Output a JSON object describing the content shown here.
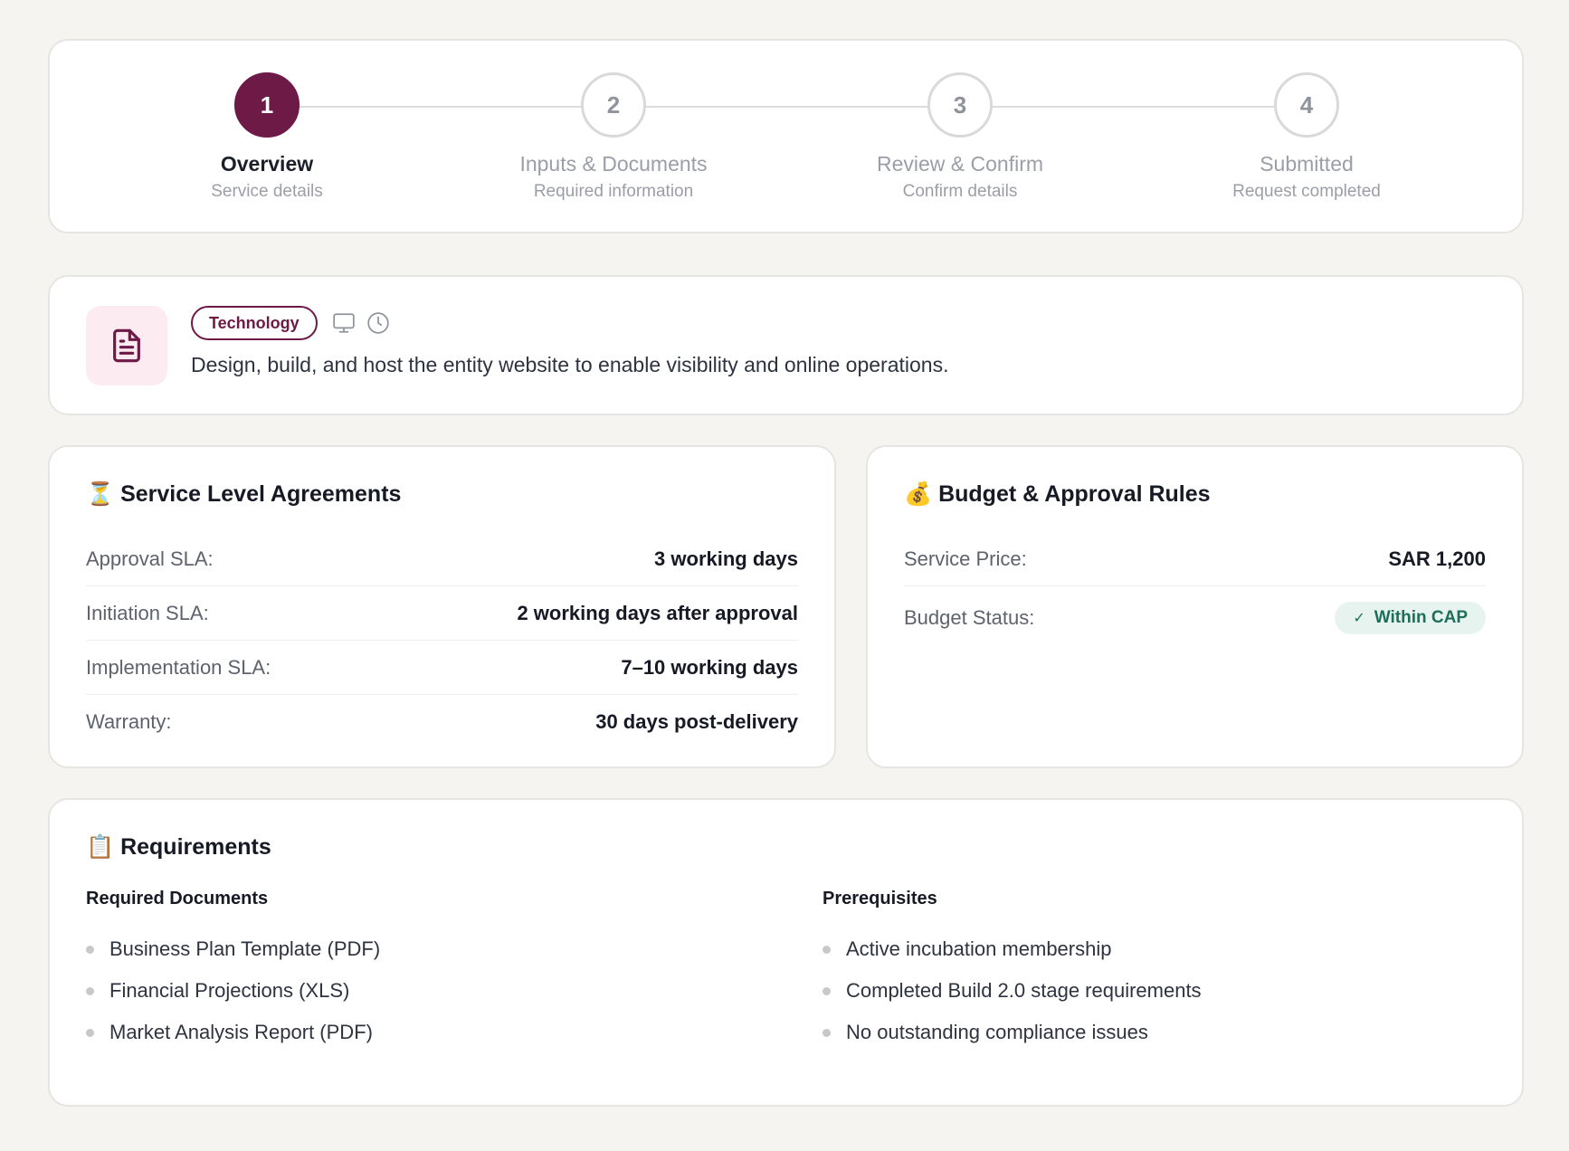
{
  "stepper": {
    "steps": [
      {
        "number": "1",
        "title": "Overview",
        "subtitle": "Service details",
        "active": true
      },
      {
        "number": "2",
        "title": "Inputs & Documents",
        "subtitle": "Required information",
        "active": false
      },
      {
        "number": "3",
        "title": "Review & Confirm",
        "subtitle": "Confirm details",
        "active": false
      },
      {
        "number": "4",
        "title": "Submitted",
        "subtitle": "Request completed",
        "active": false
      }
    ]
  },
  "service": {
    "icon": "document-icon",
    "category": "Technology",
    "meta_icons": [
      "monitor-icon",
      "clock-icon"
    ],
    "description": "Design, build, and host the entity website to enable visibility and online operations."
  },
  "sla": {
    "title": "⏳ Service Level Agreements",
    "rows": [
      {
        "label": "Approval SLA:",
        "value": "3 working days"
      },
      {
        "label": "Initiation SLA:",
        "value": "2 working days after approval"
      },
      {
        "label": "Implementation SLA:",
        "value": "7–10 working days"
      },
      {
        "label": "Warranty:",
        "value": "30 days post-delivery"
      }
    ]
  },
  "budget": {
    "title": "💰 Budget & Approval Rules",
    "price_label": "Service Price:",
    "price_value": "SAR 1,200",
    "status_label": "Budget Status:",
    "status_value": "Within CAP",
    "status_icon": "check-icon"
  },
  "requirements": {
    "title": "📋 Requirements",
    "documents_title": "Required Documents",
    "documents": [
      "Business Plan Template (PDF)",
      "Financial Projections (XLS)",
      "Market Analysis Report (PDF)"
    ],
    "prerequisites_title": "Prerequisites",
    "prerequisites": [
      "Active incubation membership",
      "Completed Build 2.0 stage requirements",
      "No outstanding compliance issues"
    ]
  },
  "colors": {
    "brand": "#6e1a47",
    "success": "#1f6e58",
    "background": "#f5f4f1"
  }
}
